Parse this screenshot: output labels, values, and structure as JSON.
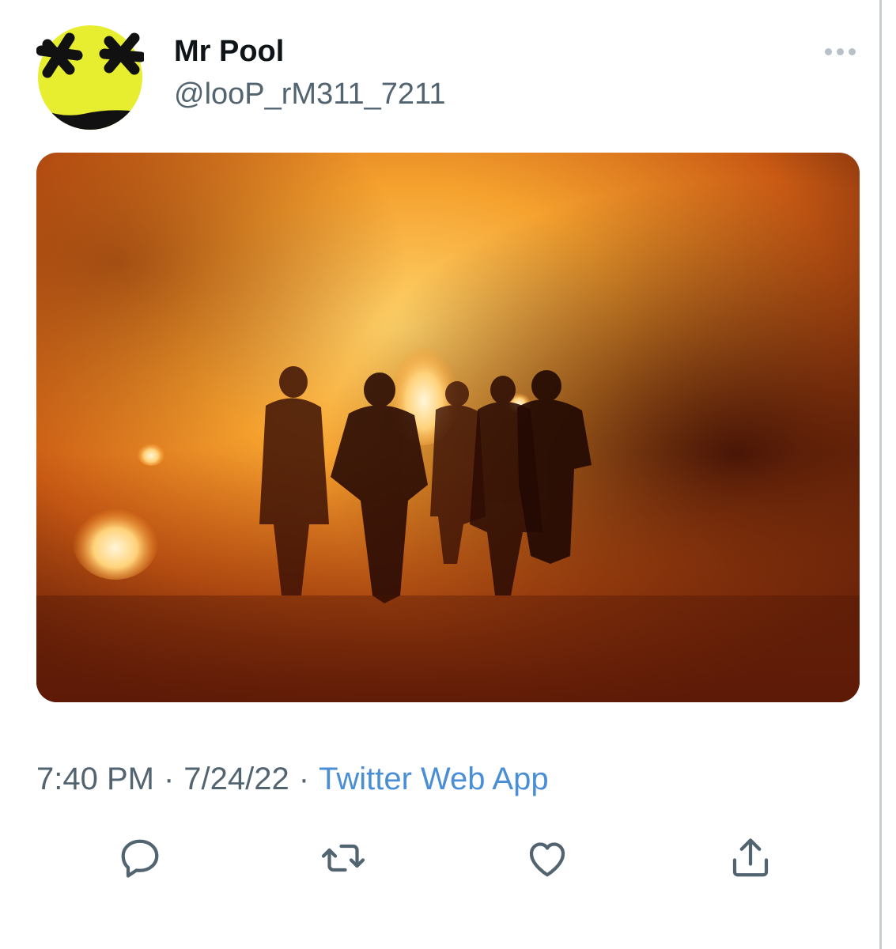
{
  "tweet": {
    "display_name": "Mr Pool",
    "handle": "@looP_rM311_7211",
    "meta": {
      "time": "7:40 PM",
      "separator": "·",
      "date": "7/24/22",
      "source": "Twitter Web App"
    }
  },
  "icons": {
    "more": "more-horizontal-icon",
    "reply": "reply-bubble-icon",
    "retweet": "retweet-icon",
    "like": "heart-icon",
    "share": "share-upload-icon"
  },
  "colors": {
    "text_primary": "#0f1419",
    "text_secondary": "#536471",
    "link": "#4a8ed6",
    "icon": "#536471",
    "avatar_yellow": "#e6ee2f"
  }
}
